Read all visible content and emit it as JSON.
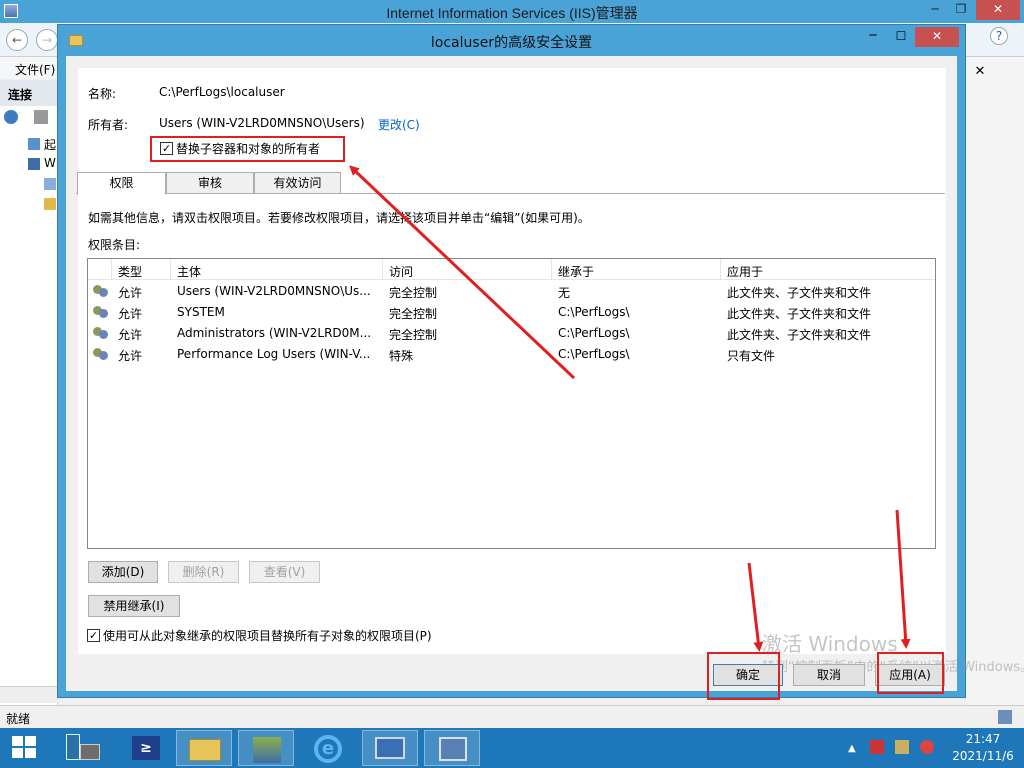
{
  "iis": {
    "title": "Internet Information Services (IIS)管理器",
    "menu_file": "文件(F)",
    "connections_label": "连接",
    "tree_item1": "起",
    "tree_item2": "W",
    "status": "就绪"
  },
  "dialog": {
    "title": "localuser的高级安全设置",
    "name_label": "名称:",
    "name_value": "C:\\PerfLogs\\localuser",
    "owner_label": "所有者:",
    "owner_value": "Users (WIN-V2LRD0MNSNO\\Users)",
    "change_link": "更改(C)",
    "replace_owner_checkbox": "替换子容器和对象的所有者",
    "tabs": [
      "权限",
      "审核",
      "有效访问"
    ],
    "info_text": "如需其他信息，请双击权限项目。若要修改权限项目，请选择该项目并单击“编辑”(如果可用)。",
    "entries_label": "权限条目:",
    "columns": [
      "类型",
      "主体",
      "访问",
      "继承于",
      "应用于"
    ],
    "rows": [
      {
        "type": "允许",
        "principal": "Users (WIN-V2LRD0MNSNO\\Us...",
        "access": "完全控制",
        "inherited": "无",
        "applies": "此文件夹、子文件夹和文件"
      },
      {
        "type": "允许",
        "principal": "SYSTEM",
        "access": "完全控制",
        "inherited": "C:\\PerfLogs\\",
        "applies": "此文件夹、子文件夹和文件"
      },
      {
        "type": "允许",
        "principal": "Administrators (WIN-V2LRD0M...",
        "access": "完全控制",
        "inherited": "C:\\PerfLogs\\",
        "applies": "此文件夹、子文件夹和文件"
      },
      {
        "type": "允许",
        "principal": "Performance Log Users (WIN-V...",
        "access": "特殊",
        "inherited": "C:\\PerfLogs\\",
        "applies": "只有文件"
      }
    ],
    "add_button": "添加(D)",
    "remove_button": "删除(R)",
    "view_button": "查看(V)",
    "disable_inheritance_button": "禁用继承(I)",
    "replace_child_checkbox": "使用可从此对象继承的权限项目替换所有子对象的权限项目(P)",
    "ok_button": "确定",
    "cancel_button": "取消",
    "apply_button": "应用(A)"
  },
  "watermark": {
    "line1": "激活 Windows",
    "line2": "转到“控制面板”中的“系统”以激活 Windows。"
  },
  "taskbar": {
    "time": "21:47",
    "date": "2021/11/6"
  },
  "colors": {
    "accent": "#4aa3d6",
    "annotation_red": "#e02020",
    "taskbar": "#1d77b8"
  }
}
